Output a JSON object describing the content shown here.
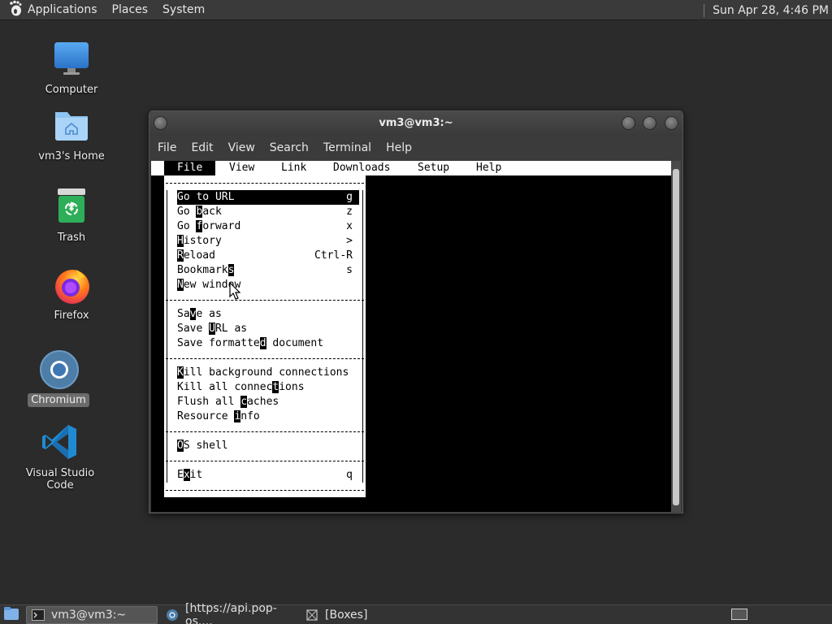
{
  "top_panel": {
    "applications": "Applications",
    "places": "Places",
    "system": "System",
    "clock": "Sun Apr 28,  4:46 PM"
  },
  "desktop": {
    "icons": [
      {
        "label": "Computer",
        "icon": "computer-icon"
      },
      {
        "label": "vm3's Home",
        "icon": "home-folder-icon"
      },
      {
        "label": "Trash",
        "icon": "trash-icon"
      },
      {
        "label": "Firefox",
        "icon": "firefox-icon"
      },
      {
        "label": "Chromium",
        "icon": "chromium-icon",
        "selected": true
      },
      {
        "label": "Visual Studio Code",
        "icon": "vscode-icon"
      }
    ]
  },
  "terminal": {
    "title": "vm3@vm3:~",
    "menu": [
      "File",
      "Edit",
      "View",
      "Search",
      "Terminal",
      "Help"
    ]
  },
  "lynx": {
    "menubar": [
      "File",
      "View",
      "Link",
      "Downloads",
      "Setup",
      "Help"
    ],
    "active_menu": "File",
    "file_menu": [
      {
        "pre": "",
        "hot": "",
        "post": "Go to URL",
        "shortcut": "g",
        "highlighted": true
      },
      {
        "pre": "Go ",
        "hot": "b",
        "post": "ack",
        "shortcut": "z"
      },
      {
        "pre": "Go ",
        "hot": "f",
        "post": "orward",
        "shortcut": "x"
      },
      {
        "pre": "",
        "hot": "H",
        "post": "istory",
        "shortcut": ">"
      },
      {
        "pre": "",
        "hot": "R",
        "post": "eload",
        "shortcut": "Ctrl-R"
      },
      {
        "pre": "Bookmark",
        "hot": "s",
        "post": "",
        "shortcut": "s"
      },
      {
        "pre": "",
        "hot": "N",
        "post": "ew window",
        "shortcut": ""
      },
      {
        "separator": true
      },
      {
        "pre": "Sa",
        "hot": "v",
        "post": "e as",
        "shortcut": ""
      },
      {
        "pre": "Save ",
        "hot": "U",
        "post": "RL as",
        "shortcut": ""
      },
      {
        "pre": "Save formatte",
        "hot": "d",
        "post": " document",
        "shortcut": ""
      },
      {
        "separator": true
      },
      {
        "pre": "",
        "hot": "K",
        "post": "ill background connections",
        "shortcut": ""
      },
      {
        "pre": "Kill all connec",
        "hot": "t",
        "post": "ions",
        "shortcut": ""
      },
      {
        "pre": "Flush all ",
        "hot": "c",
        "post": "aches",
        "shortcut": ""
      },
      {
        "pre": "Resource ",
        "hot": "i",
        "post": "nfo",
        "shortcut": ""
      },
      {
        "separator": true
      },
      {
        "pre": "",
        "hot": "O",
        "post": "S shell",
        "shortcut": ""
      },
      {
        "separator": true
      },
      {
        "pre": "E",
        "hot": "x",
        "post": "it",
        "shortcut": "q"
      }
    ]
  },
  "taskbar": {
    "tasks": [
      {
        "label": "vm3@vm3:~",
        "icon": "terminal-icon",
        "active": true
      },
      {
        "label": "[https://api.pop-os....",
        "icon": "chromium-icon"
      },
      {
        "label": "[Boxes]",
        "icon": "boxes-icon"
      }
    ]
  }
}
